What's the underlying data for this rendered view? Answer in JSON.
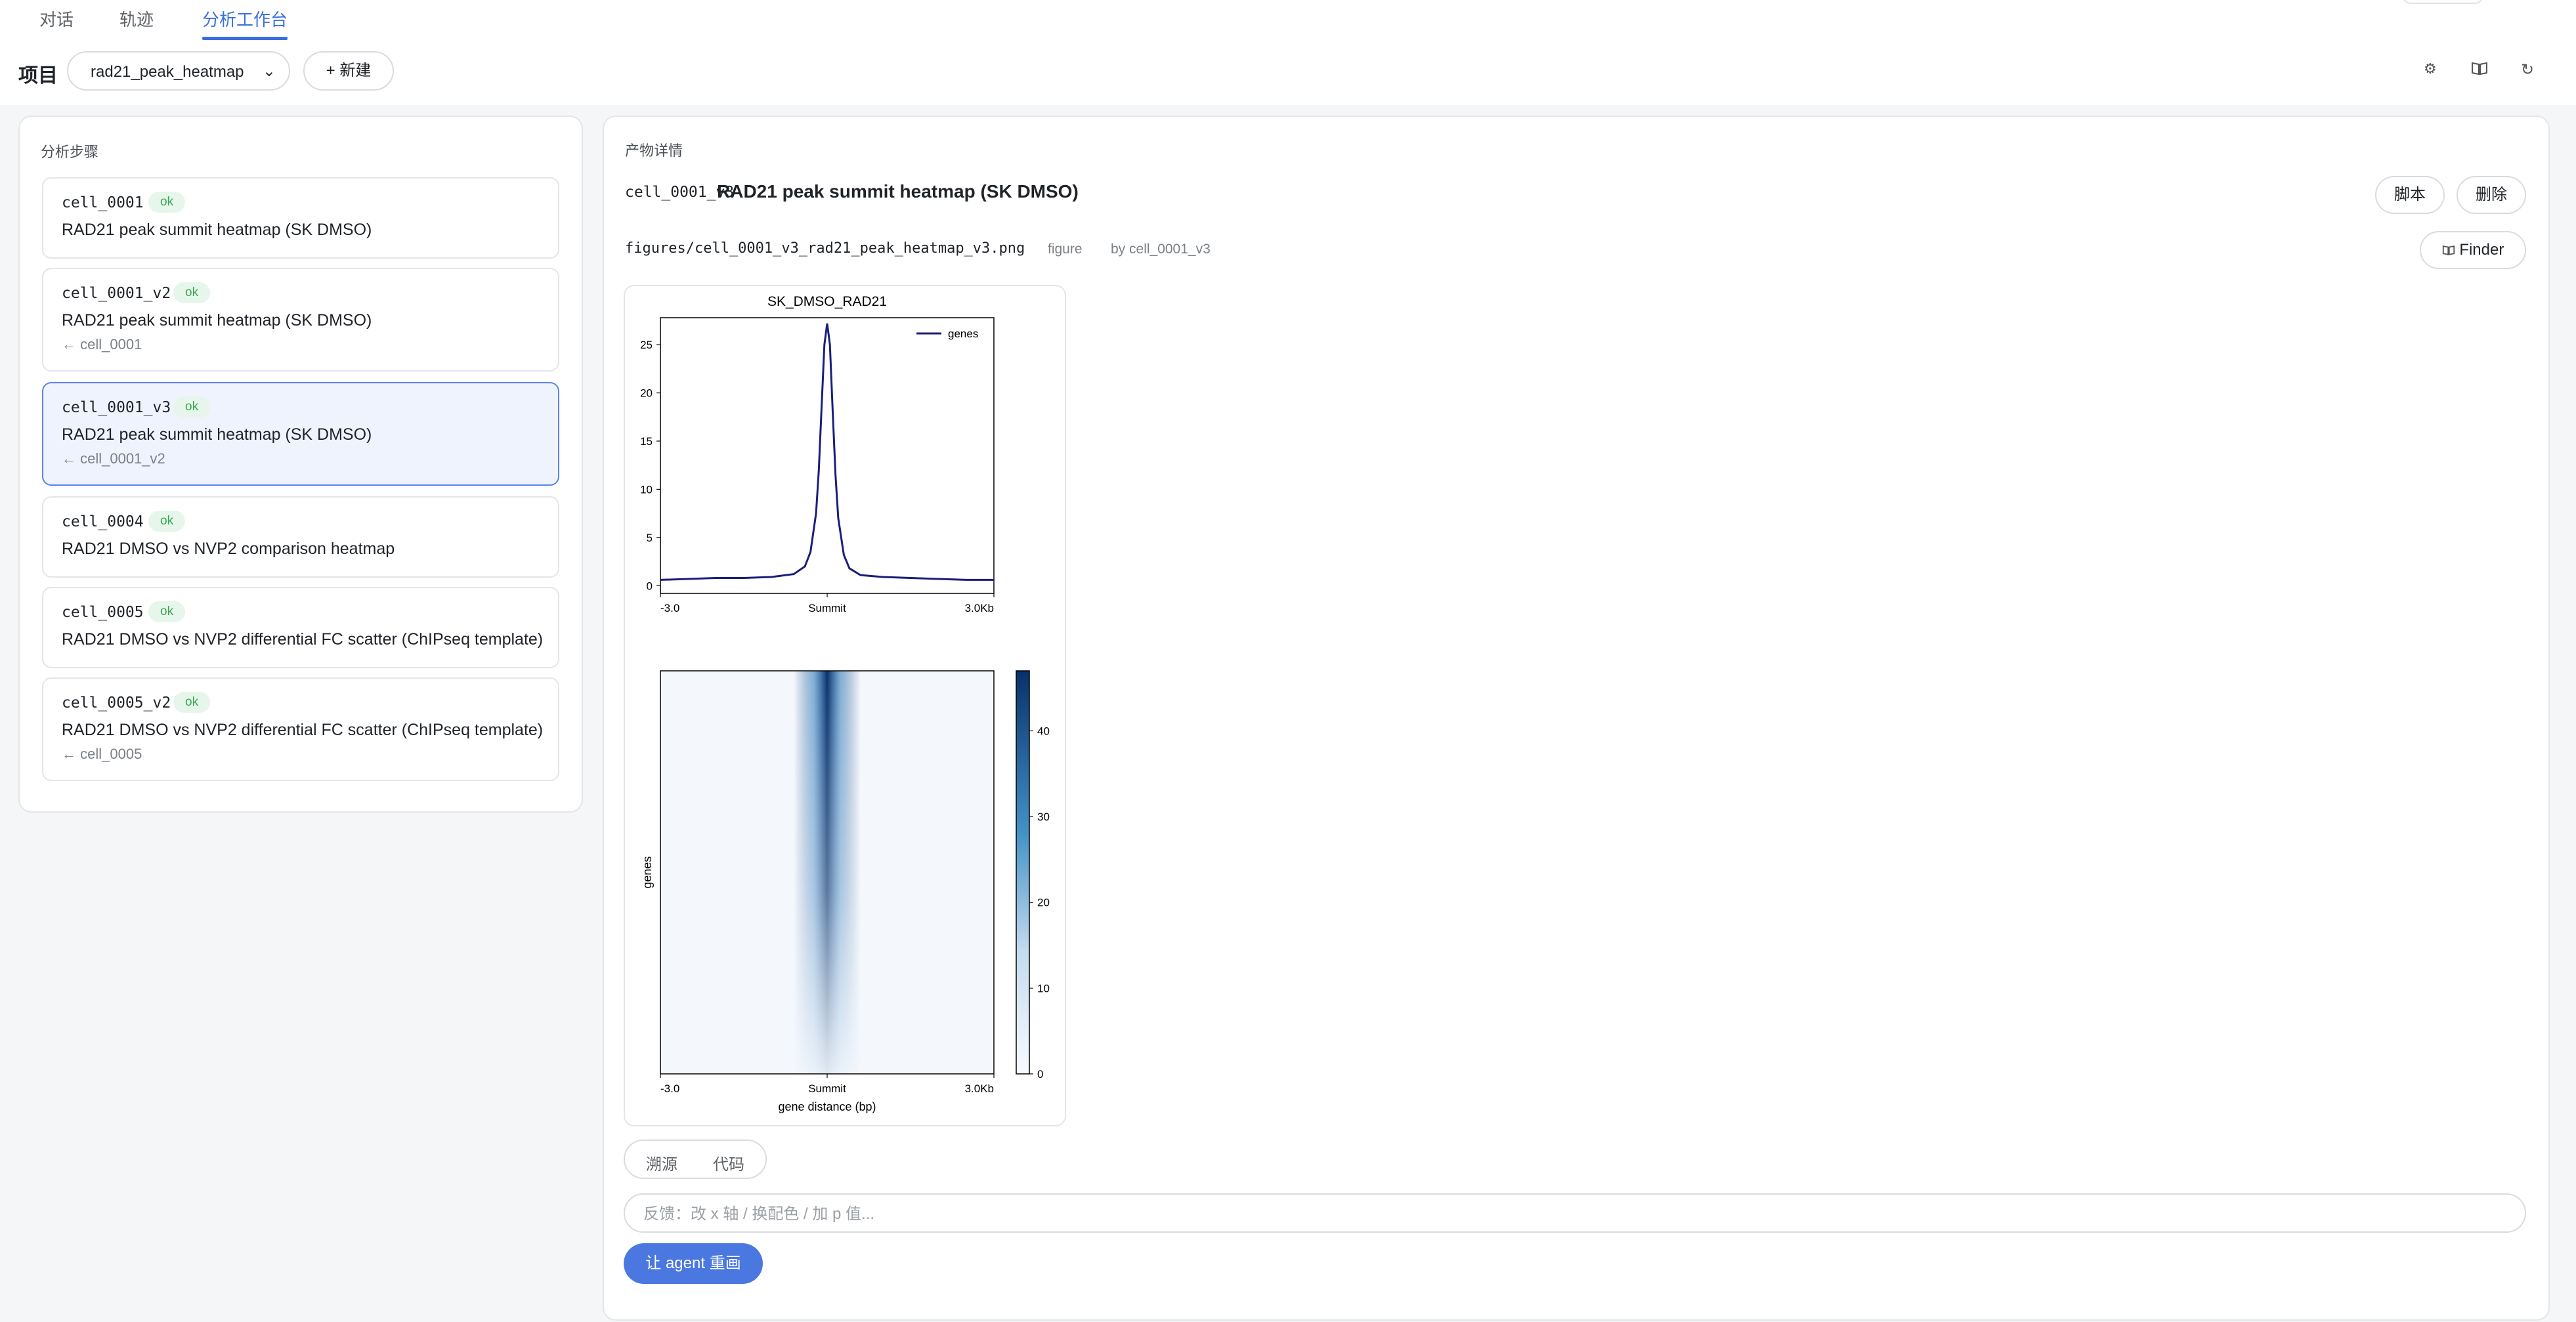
{
  "tabs": [
    {
      "label": "对话",
      "active": false
    },
    {
      "label": "轨迹",
      "active": false
    },
    {
      "label": "分析工作台",
      "active": true
    }
  ],
  "project": {
    "label": "项目",
    "selected": "rad21_peak_heatmap",
    "new_label": "+ 新建",
    "tool_icons": [
      "gear-icon",
      "book-icon",
      "refresh-icon"
    ]
  },
  "steps": {
    "title": "分析步骤",
    "items": [
      {
        "id": "cell_0001",
        "status": "ok",
        "title": "RAD21 peak summit heatmap (SK DMSO)",
        "parent": ""
      },
      {
        "id": "cell_0001_v2",
        "status": "ok",
        "title": "RAD21 peak summit heatmap (SK DMSO)",
        "parent": "← cell_0001"
      },
      {
        "id": "cell_0001_v3",
        "status": "ok",
        "title": "RAD21 peak summit heatmap (SK DMSO)",
        "parent": "← cell_0001_v2",
        "active": true
      },
      {
        "id": "cell_0004",
        "status": "ok",
        "title": "RAD21 DMSO vs NVP2 comparison heatmap",
        "parent": ""
      },
      {
        "id": "cell_0005",
        "status": "ok",
        "title": "RAD21 DMSO vs NVP2 differential FC scatter (ChIPseq template)",
        "parent": ""
      },
      {
        "id": "cell_0005_v2",
        "status": "ok",
        "title": "RAD21 DMSO vs NVP2 differential FC scatter (ChIPseq template)",
        "parent": "← cell_0005"
      }
    ]
  },
  "detail": {
    "title": "产物详情",
    "artifact_id": "cell_0001_v3",
    "artifact_title": "RAD21 peak summit heatmap (SK DMSO)",
    "script_label": "脚本",
    "delete_label": "删除",
    "path": "figures/cell_0001_v3_rad21_peak_heatmap_v3.png",
    "kind": "figure",
    "by": "by cell_0001_v3",
    "finder_label": "Finder",
    "seg_labels": [
      "溯源",
      "代码"
    ],
    "feedback_placeholder": "反馈：改 x 轴 / 换配色 / 加 p 值...",
    "redraw_label": "让 agent 重画"
  },
  "chart_data": [
    {
      "type": "line",
      "title": "SK_DMSO_RAD21",
      "series": [
        {
          "name": "genes",
          "color": "#1a1f7a",
          "x": [
            -3000,
            -2500,
            -2000,
            -1500,
            -1000,
            -600,
            -400,
            -300,
            -200,
            -150,
            -100,
            -50,
            0,
            50,
            100,
            150,
            200,
            300,
            400,
            600,
            1000,
            1500,
            2000,
            2500,
            3000
          ],
          "values": [
            0.6,
            0.7,
            0.8,
            0.8,
            0.9,
            1.2,
            2.0,
            3.5,
            7.5,
            12.0,
            18.5,
            25.0,
            27.2,
            25.0,
            18.0,
            11.5,
            7.0,
            3.2,
            1.8,
            1.1,
            0.9,
            0.8,
            0.7,
            0.6,
            0.6
          ]
        }
      ],
      "xticks": [
        "-3.0",
        "Summit",
        "3.0Kb"
      ],
      "yticks": [
        0,
        5,
        10,
        15,
        20,
        25
      ],
      "ylim": [
        -0.8,
        27.8
      ],
      "legend": "top-right"
    },
    {
      "type": "heatmap",
      "ylabel": "genes",
      "xlabel": "gene distance (bp)",
      "xticks": [
        "-3.0",
        "Summit",
        "3.0Kb"
      ],
      "colorbar_ticks": [
        0,
        10,
        20,
        30,
        40
      ],
      "colorbar_range": [
        0,
        47
      ],
      "colormap": [
        "#f7fbff",
        "#08306b"
      ]
    }
  ]
}
